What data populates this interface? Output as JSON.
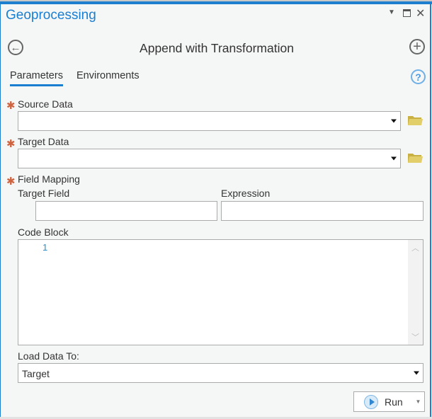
{
  "window": {
    "title": "Geoprocessing",
    "controls": [
      "options",
      "maximize",
      "close"
    ]
  },
  "tool": {
    "title": "Append with Transformation"
  },
  "tabs": [
    {
      "label": "Parameters",
      "active": true
    },
    {
      "label": "Environments",
      "active": false
    }
  ],
  "params": {
    "source_data": {
      "label": "Source Data",
      "value": ""
    },
    "target_data": {
      "label": "Target Data",
      "value": ""
    },
    "field_mapping": {
      "label": "Field Mapping",
      "target_field_label": "Target Field",
      "expression_label": "Expression",
      "target_field_value": "",
      "expression_value": ""
    },
    "code_block": {
      "label": "Code Block",
      "line_number": "1"
    },
    "load_data_to": {
      "label": "Load Data To:",
      "value": "Target"
    }
  },
  "run": {
    "label": "Run"
  },
  "colors": {
    "accent": "#1a7fd1",
    "required": "#d0633e",
    "folder": "#d9c55a"
  }
}
